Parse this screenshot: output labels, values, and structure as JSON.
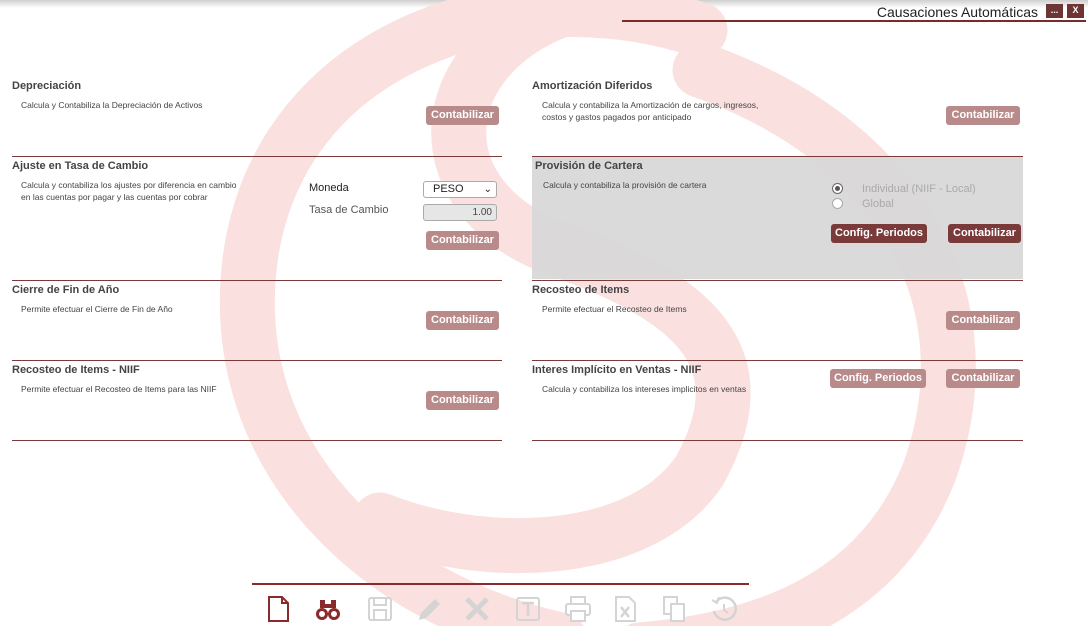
{
  "window": {
    "title": "Causaciones Automáticas",
    "minimize_label": "...",
    "close_label": "X"
  },
  "sections": {
    "depreciacion": {
      "title": "Depreciación",
      "description": "Calcula y Contabiliza la Depreciación de Activos",
      "button": "Contabilizar"
    },
    "amortizacion": {
      "title": "Amortización Diferidos",
      "description_line1": "Calcula y contabiliza la Amortización de cargos, ingresos,",
      "description_line2": "costos y gastos pagados por anticipado",
      "button": "Contabilizar"
    },
    "ajuste": {
      "title": "Ajuste en Tasa de Cambio",
      "description_line1": "Calcula y contabiliza los ajustes por diferencia en cambio",
      "description_line2": "en las cuentas por pagar y las cuentas por cobrar",
      "moneda_label": "Moneda",
      "moneda_value": "PESO",
      "tasa_label": "Tasa de Cambio",
      "tasa_value": "1.00",
      "button": "Contabilizar"
    },
    "provision": {
      "title": "Provisión de Cartera",
      "description": "Calcula y contabiliza la provisión de cartera",
      "radio_individual": "Individual (NIIF - Local)",
      "radio_global": "Global",
      "selected": "Individual (NIIF - Local)",
      "config_button": "Config. Periodos",
      "button": "Contabilizar"
    },
    "cierre": {
      "title": "Cierre de Fin de Año",
      "description": "Permite efectuar el Cierre de Fin de Año",
      "button": "Contabilizar"
    },
    "recosteo": {
      "title": "Recosteo de Items",
      "description": "Permite efectuar el Recosteo de Items",
      "button": "Contabilizar"
    },
    "recosteo_niif": {
      "title": "Recosteo de Items - NIIF",
      "description": "Permite efectuar el Recosteo de Items para las NIIF",
      "button": "Contabilizar"
    },
    "interes": {
      "title": "Interes Implícito en Ventas - NIIF",
      "description": "Calcula y contabiliza los intereses implicitos en ventas",
      "config_button": "Config. Periodos",
      "button": "Contabilizar"
    }
  },
  "toolbar": {
    "icons": [
      "new-document-icon",
      "binoculars-search-icon",
      "save-icon",
      "edit-pencil-icon",
      "delete-x-icon",
      "text-icon",
      "print-icon",
      "excel-export-icon",
      "copy-icon",
      "history-icon"
    ]
  },
  "colors": {
    "accent": "#7a3a3a",
    "button_light": "#b88a8a",
    "watermark": "#fbe0e0"
  }
}
